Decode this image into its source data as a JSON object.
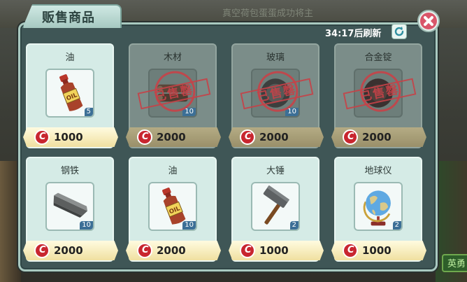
{
  "background": {
    "banner_text": "真空荷包蛋蛋成功将主",
    "side_button_label": "英勇"
  },
  "shop": {
    "title": "贩售商品",
    "refresh_timer": "34:17后刷新",
    "sold_label": "已售罄",
    "items": [
      {
        "name": "油",
        "price": "1000",
        "quantity": "5",
        "sold_out": false,
        "icon": "oil-bottle-icon"
      },
      {
        "name": "木材",
        "price": "2000",
        "quantity": "10",
        "sold_out": true,
        "icon": "wood-icon"
      },
      {
        "name": "玻璃",
        "price": "2000",
        "quantity": "10",
        "sold_out": true,
        "icon": "glass-icon"
      },
      {
        "name": "合金锭",
        "price": "2000",
        "quantity": "",
        "sold_out": true,
        "icon": "alloy-ingot-icon"
      },
      {
        "name": "钢铁",
        "price": "2000",
        "quantity": "10",
        "sold_out": false,
        "icon": "steel-bar-icon"
      },
      {
        "name": "油",
        "price": "2000",
        "quantity": "10",
        "sold_out": false,
        "icon": "oil-bottle-icon"
      },
      {
        "name": "大锤",
        "price": "1000",
        "quantity": "2",
        "sold_out": false,
        "icon": "sledgehammer-icon"
      },
      {
        "name": "地球仪",
        "price": "1000",
        "quantity": "2",
        "sold_out": false,
        "icon": "globe-icon"
      }
    ]
  },
  "colors": {
    "panel": "#3f5656",
    "card": "#d5ebe6",
    "sold_card": "#7b8d89",
    "coin": "#c8262f",
    "stamp": "#c64248"
  }
}
